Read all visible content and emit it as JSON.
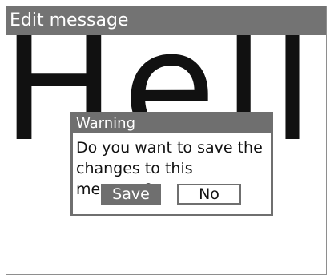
{
  "window": {
    "title": "Edit message"
  },
  "message": {
    "text": "Hello"
  },
  "dialog": {
    "title": "Warning",
    "body_line1": "Do you want to save the",
    "body_line2": "changes to this message?",
    "save_label": "Save",
    "no_label": "No"
  },
  "colors": {
    "titlebar": "#737373",
    "dialog_border": "#6f6f6f",
    "background": "#ffffff",
    "text": "#111111"
  }
}
